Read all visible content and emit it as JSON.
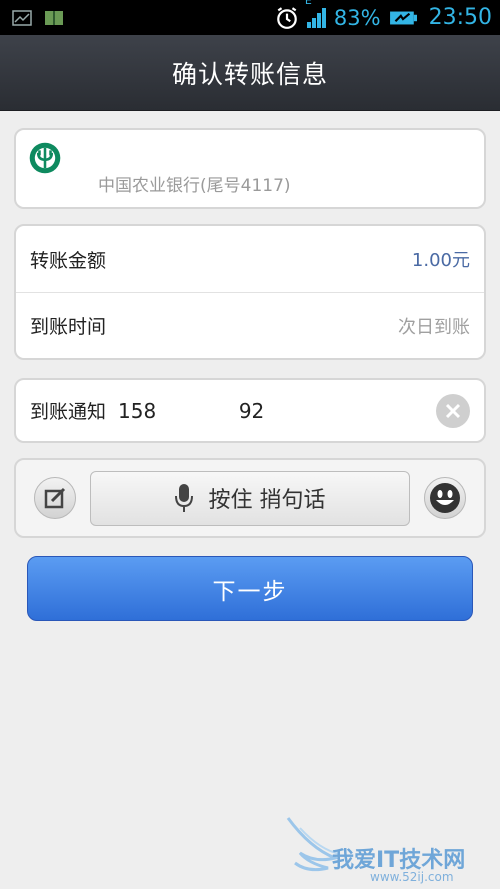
{
  "status_bar": {
    "signal_label": "E",
    "battery_percent": "83%",
    "time": "23:50",
    "icons": [
      "chart-icon",
      "book-icon",
      "alarm-icon",
      "signal-icon",
      "battery-icon"
    ]
  },
  "header": {
    "title": "确认转账信息"
  },
  "bank": {
    "name": "中国农业银行(尾号4117)",
    "logo": "abc-bank-logo"
  },
  "transfer": {
    "amount_label": "转账金额",
    "amount_value": "1.00元",
    "time_label": "到账时间",
    "time_value": "次日到账"
  },
  "notify": {
    "label": "到账通知",
    "value": "158             92"
  },
  "voice": {
    "hold_label": "按住 捎句话"
  },
  "next_button": {
    "label": "下一步"
  },
  "watermark": {
    "title": "我爱IT技术网",
    "sub": "www.52ij.com"
  },
  "colors": {
    "accent": "#33b5e5",
    "primary_button": "#3a7be0",
    "bank_green": "#0e8a5f",
    "amount_blue": "#4a6aa4"
  }
}
